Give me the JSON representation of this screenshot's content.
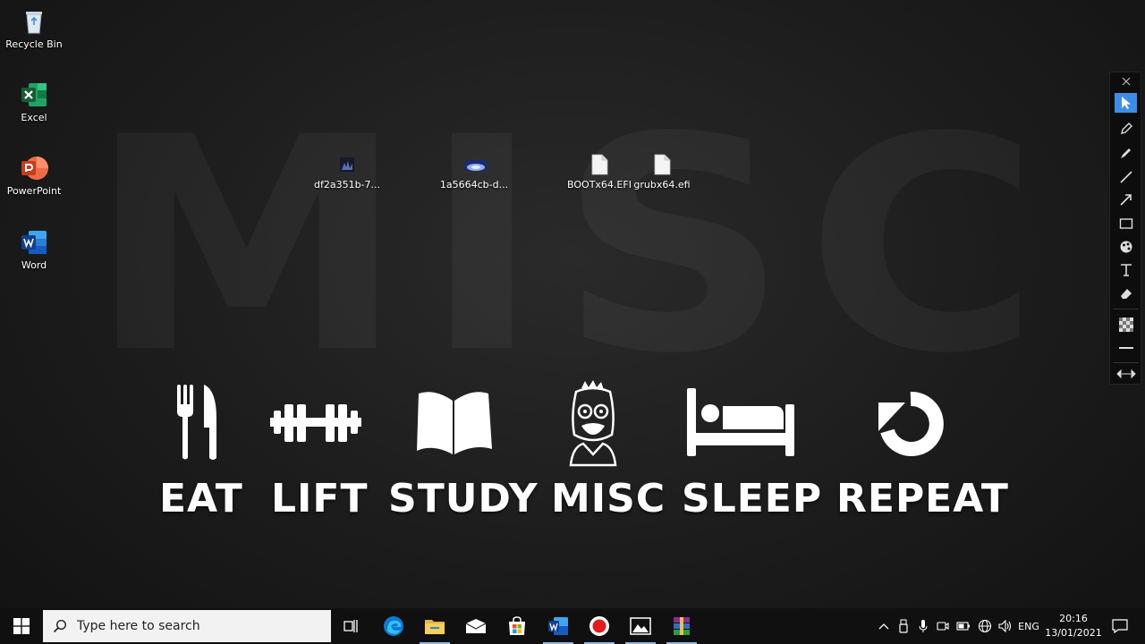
{
  "wallpaper": {
    "watermark": "MISC",
    "motto": [
      "EAT",
      "LIFT",
      "STUDY",
      "MISC",
      "SLEEP",
      "REPEAT"
    ]
  },
  "desktop": {
    "shortcuts": [
      {
        "label": "Recycle Bin",
        "icon": "recycle-bin-icon"
      },
      {
        "label": "Excel",
        "icon": "excel-icon"
      },
      {
        "label": "PowerPoint",
        "icon": "powerpoint-icon"
      },
      {
        "label": "Word",
        "icon": "word-icon"
      }
    ],
    "files": [
      {
        "label": "df2a351b-7...",
        "icon": "image-file-icon"
      },
      {
        "label": "1a5664cb-d...",
        "icon": "image-file-icon"
      },
      {
        "label": "BOOTx64.EFI",
        "icon": "blank-file-icon"
      },
      {
        "label": "grubx64.efi",
        "icon": "blank-file-icon"
      }
    ]
  },
  "annotation_toolbar": {
    "tools": [
      "close-icon",
      "pointer-icon",
      "pen-icon",
      "marker-icon",
      "line-icon",
      "arrow-icon",
      "rectangle-icon",
      "color-palette-icon",
      "text-icon",
      "eraser-icon",
      "checker-icon",
      "line-width-icon",
      "resize-icon"
    ],
    "active_tool": "pointer-icon",
    "accent": "#3b8ee8"
  },
  "taskbar": {
    "search_placeholder": "Type here to search",
    "apps": [
      "task-view-icon",
      "edge-icon",
      "file-explorer-icon",
      "mail-icon",
      "store-icon",
      "word-icon",
      "record-icon",
      "photos-icon",
      "winrar-icon"
    ],
    "running": [
      "file-explorer-icon",
      "word-icon",
      "record-icon",
      "photos-icon",
      "winrar-icon"
    ],
    "language": "ENG",
    "time": "20:16",
    "date": "13/01/2021"
  }
}
